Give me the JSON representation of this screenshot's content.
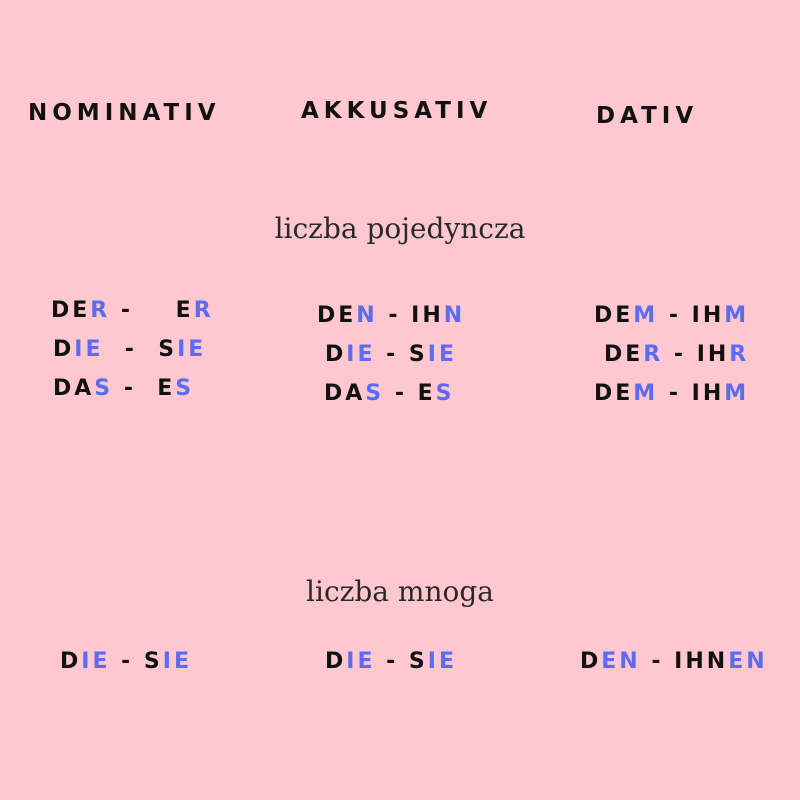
{
  "colors": {
    "background": "#ffc8d0",
    "text": "#111111",
    "highlight": "#5b6cf0",
    "section_title": "#2a2a2a"
  },
  "headers": {
    "nominativ": "NOMINATIV",
    "akkusativ": "AKKUSATIV",
    "dativ": "DATIV"
  },
  "sections": {
    "singular_title": "liczba pojedyncza",
    "plural_title": "liczba mnoga"
  },
  "singular": {
    "nominativ": [
      [
        {
          "t": "DE",
          "h": false
        },
        {
          "t": "R",
          "h": true
        },
        {
          "t": " -    E",
          "h": false
        },
        {
          "t": "R",
          "h": true
        }
      ],
      [
        {
          "t": "D",
          "h": false
        },
        {
          "t": "IE",
          "h": true
        },
        {
          "t": "  -  S",
          "h": false
        },
        {
          "t": "IE",
          "h": true
        }
      ],
      [
        {
          "t": "DA",
          "h": false
        },
        {
          "t": "S",
          "h": true
        },
        {
          "t": " -  E",
          "h": false
        },
        {
          "t": "S",
          "h": true
        }
      ]
    ],
    "akkusativ": [
      [
        {
          "t": "DE",
          "h": false
        },
        {
          "t": "N",
          "h": true
        },
        {
          "t": " - IH",
          "h": false
        },
        {
          "t": "N",
          "h": true
        }
      ],
      [
        {
          "t": "D",
          "h": false
        },
        {
          "t": "IE",
          "h": true
        },
        {
          "t": " - S",
          "h": false
        },
        {
          "t": "IE",
          "h": true
        }
      ],
      [
        {
          "t": "DA",
          "h": false
        },
        {
          "t": "S",
          "h": true
        },
        {
          "t": " - E",
          "h": false
        },
        {
          "t": "S",
          "h": true
        }
      ]
    ],
    "dativ": [
      [
        {
          "t": "DE",
          "h": false
        },
        {
          "t": "M",
          "h": true
        },
        {
          "t": " - IH",
          "h": false
        },
        {
          "t": "M",
          "h": true
        }
      ],
      [
        {
          "t": "DE",
          "h": false
        },
        {
          "t": "R",
          "h": true
        },
        {
          "t": " - IH",
          "h": false
        },
        {
          "t": "R",
          "h": true
        }
      ],
      [
        {
          "t": "DE",
          "h": false
        },
        {
          "t": "M",
          "h": true
        },
        {
          "t": " - IH",
          "h": false
        },
        {
          "t": "M",
          "h": true
        }
      ]
    ]
  },
  "plural": {
    "nominativ": [
      {
        "t": "D",
        "h": false
      },
      {
        "t": "IE",
        "h": true
      },
      {
        "t": " - S",
        "h": false
      },
      {
        "t": "IE",
        "h": true
      }
    ],
    "akkusativ": [
      {
        "t": "D",
        "h": false
      },
      {
        "t": "IE",
        "h": true
      },
      {
        "t": " - S",
        "h": false
      },
      {
        "t": "IE",
        "h": true
      }
    ],
    "dativ": [
      {
        "t": "D",
        "h": false
      },
      {
        "t": "EN",
        "h": true
      },
      {
        "t": " - IHN",
        "h": false
      },
      {
        "t": "EN",
        "h": true
      }
    ]
  }
}
